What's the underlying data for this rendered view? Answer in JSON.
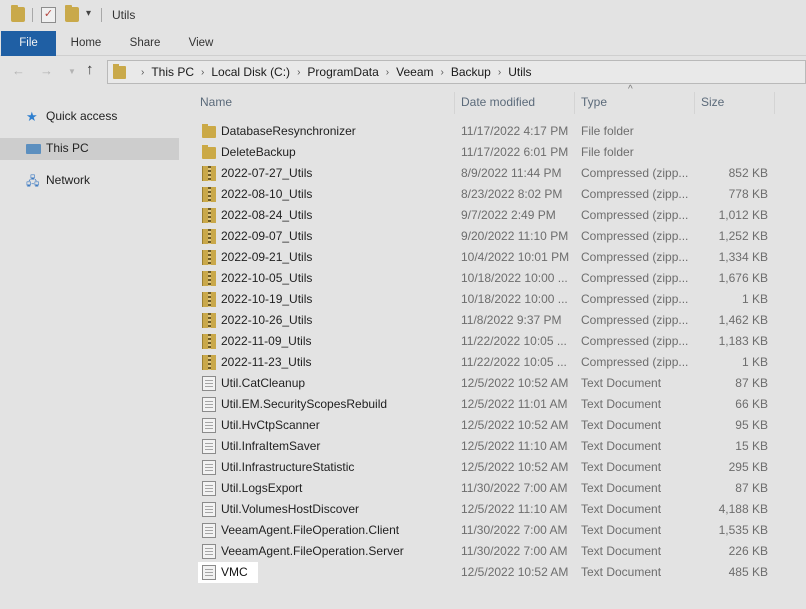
{
  "window": {
    "title": "Utils"
  },
  "ribbon": {
    "tabs": [
      "File",
      "Home",
      "Share",
      "View"
    ]
  },
  "address": {
    "crumbs": [
      "This PC",
      "Local Disk (C:)",
      "ProgramData",
      "Veeam",
      "Backup",
      "Utils"
    ]
  },
  "navpane": {
    "items": [
      {
        "label": "Quick access",
        "icon": "star-icon"
      },
      {
        "label": "This PC",
        "icon": "computer-icon",
        "selected": true
      },
      {
        "label": "Network",
        "icon": "network-icon"
      }
    ]
  },
  "columns": {
    "name": "Name",
    "date": "Date modified",
    "type": "Type",
    "size": "Size"
  },
  "files": [
    {
      "name": "DatabaseResynchronizer",
      "date": "11/17/2022 4:17 PM",
      "type": "File folder",
      "size": "",
      "icon": "folder-icon"
    },
    {
      "name": "DeleteBackup",
      "date": "11/17/2022 6:01 PM",
      "type": "File folder",
      "size": "",
      "icon": "folder-icon"
    },
    {
      "name": "2022-07-27_Utils",
      "date": "8/9/2022 11:44 PM",
      "type": "Compressed (zipp...",
      "size": "852 KB",
      "icon": "zip-icon"
    },
    {
      "name": "2022-08-10_Utils",
      "date": "8/23/2022 8:02 PM",
      "type": "Compressed (zipp...",
      "size": "778 KB",
      "icon": "zip-icon"
    },
    {
      "name": "2022-08-24_Utils",
      "date": "9/7/2022 2:49 PM",
      "type": "Compressed (zipp...",
      "size": "1,012 KB",
      "icon": "zip-icon"
    },
    {
      "name": "2022-09-07_Utils",
      "date": "9/20/2022 11:10 PM",
      "type": "Compressed (zipp...",
      "size": "1,252 KB",
      "icon": "zip-icon"
    },
    {
      "name": "2022-09-21_Utils",
      "date": "10/4/2022 10:01 PM",
      "type": "Compressed (zipp...",
      "size": "1,334 KB",
      "icon": "zip-icon"
    },
    {
      "name": "2022-10-05_Utils",
      "date": "10/18/2022 10:00 ...",
      "type": "Compressed (zipp...",
      "size": "1,676 KB",
      "icon": "zip-icon"
    },
    {
      "name": "2022-10-19_Utils",
      "date": "10/18/2022 10:00 ...",
      "type": "Compressed (zipp...",
      "size": "1 KB",
      "icon": "zip-icon"
    },
    {
      "name": "2022-10-26_Utils",
      "date": "11/8/2022 9:37 PM",
      "type": "Compressed (zipp...",
      "size": "1,462 KB",
      "icon": "zip-icon"
    },
    {
      "name": "2022-11-09_Utils",
      "date": "11/22/2022 10:05 ...",
      "type": "Compressed (zipp...",
      "size": "1,183 KB",
      "icon": "zip-icon"
    },
    {
      "name": "2022-11-23_Utils",
      "date": "11/22/2022 10:05 ...",
      "type": "Compressed (zipp...",
      "size": "1 KB",
      "icon": "zip-icon"
    },
    {
      "name": "Util.CatCleanup",
      "date": "12/5/2022 10:52 AM",
      "type": "Text Document",
      "size": "87 KB",
      "icon": "text-file-icon"
    },
    {
      "name": "Util.EM.SecurityScopesRebuild",
      "date": "12/5/2022 11:01 AM",
      "type": "Text Document",
      "size": "66 KB",
      "icon": "text-file-icon"
    },
    {
      "name": "Util.HvCtpScanner",
      "date": "12/5/2022 10:52 AM",
      "type": "Text Document",
      "size": "95 KB",
      "icon": "text-file-icon"
    },
    {
      "name": "Util.InfraItemSaver",
      "date": "12/5/2022 11:10 AM",
      "type": "Text Document",
      "size": "15 KB",
      "icon": "text-file-icon"
    },
    {
      "name": "Util.InfrastructureStatistic",
      "date": "12/5/2022 10:52 AM",
      "type": "Text Document",
      "size": "295 KB",
      "icon": "text-file-icon"
    },
    {
      "name": "Util.LogsExport",
      "date": "11/30/2022 7:00 AM",
      "type": "Text Document",
      "size": "87 KB",
      "icon": "text-file-icon"
    },
    {
      "name": "Util.VolumesHostDiscover",
      "date": "12/5/2022 11:10 AM",
      "type": "Text Document",
      "size": "4,188 KB",
      "icon": "text-file-icon"
    },
    {
      "name": "VeeamAgent.FileOperation.Client",
      "date": "11/30/2022 7:00 AM",
      "type": "Text Document",
      "size": "1,535 KB",
      "icon": "text-file-icon"
    },
    {
      "name": "VeeamAgent.FileOperation.Server",
      "date": "11/30/2022 7:00 AM",
      "type": "Text Document",
      "size": "226 KB",
      "icon": "text-file-icon"
    },
    {
      "name": "VMC",
      "date": "12/5/2022 10:52 AM",
      "type": "Text Document",
      "size": "485 KB",
      "icon": "text-file-icon",
      "highlighted": true
    }
  ],
  "colors": {
    "file_tab": "#1f5fa4",
    "folder": "#cba946",
    "highlight": "#ffffff"
  }
}
